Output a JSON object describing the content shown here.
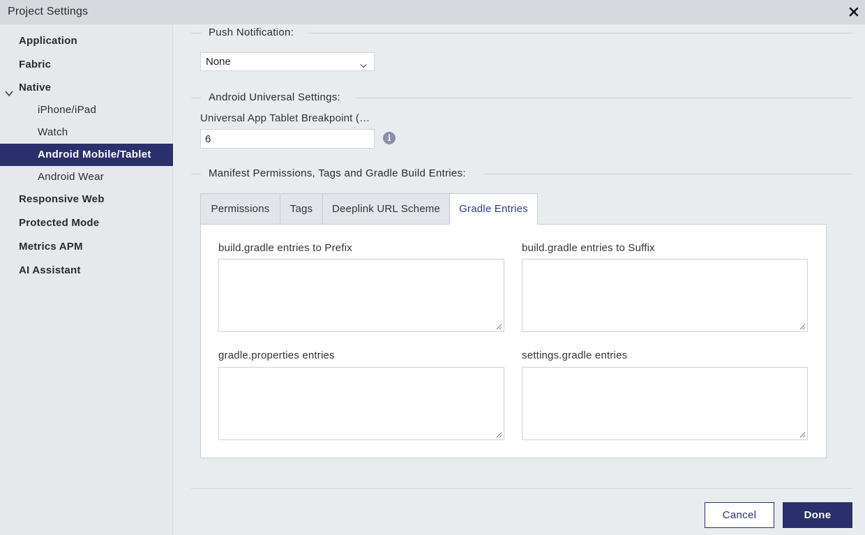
{
  "window": {
    "title": "Project Settings"
  },
  "sidebar": {
    "items": [
      {
        "label": "Application"
      },
      {
        "label": "Fabric"
      },
      {
        "label": "Native"
      },
      {
        "label": "iPhone/iPad"
      },
      {
        "label": "Watch"
      },
      {
        "label": "Android Mobile/Tablet"
      },
      {
        "label": "Android Wear"
      },
      {
        "label": "Responsive Web"
      },
      {
        "label": "Protected Mode"
      },
      {
        "label": "Metrics APM"
      },
      {
        "label": "AI Assistant"
      }
    ]
  },
  "push": {
    "section_label": "Push Notification:",
    "selected": "None"
  },
  "android_universal": {
    "section_label": "Android Universal Settings:",
    "field_label": "Universal App Tablet Breakpoint (…",
    "value": "6"
  },
  "manifest": {
    "section_label": "Manifest Permissions, Tags and Gradle Build Entries:",
    "tabs": [
      {
        "label": "Permissions"
      },
      {
        "label": "Tags"
      },
      {
        "label": "Deeplink URL Scheme"
      },
      {
        "label": "Gradle Entries"
      }
    ],
    "active_tab": "Gradle Entries",
    "fields": {
      "prefix_label": "build.gradle entries to Prefix",
      "suffix_label": "build.gradle entries to Suffix",
      "properties_label": "gradle.properties entries",
      "settings_label": "settings.gradle entries"
    }
  },
  "footer": {
    "cancel_label": "Cancel",
    "done_label": "Done"
  },
  "colors": {
    "accent": "#2b2f6b",
    "active_tab_text": "#2f3a8a",
    "info_icon": "#8a8fa8"
  }
}
